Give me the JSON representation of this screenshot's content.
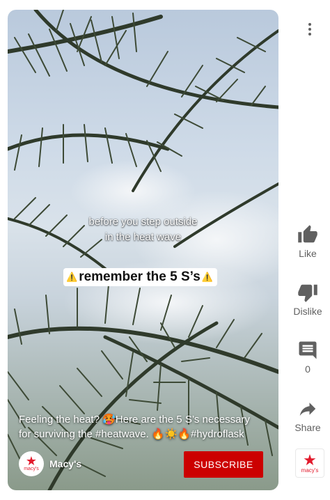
{
  "video": {
    "caption_line1": "before you step outside",
    "caption_line2": "in the heat wave",
    "highlight_text": "remember the 5 S’s",
    "warning_glyph": "⚠️",
    "description_line1": "Feeling the heat? 🥵Here are the 5 S’s necessary",
    "description_line2": "for surviving the #heatwave. 🔥☀️🔥#hydroflask"
  },
  "channel": {
    "name": "Macy's",
    "avatar_star": "★",
    "avatar_text": "macy's",
    "subscribe_label": "SUBSCRIBE"
  },
  "actions": {
    "more_icon": "more-vertical-icon",
    "like_label": "Like",
    "dislike_label": "Dislike",
    "comment_count": "0",
    "share_label": "Share"
  },
  "brand_tile": {
    "star": "★",
    "text": "macy's"
  },
  "colors": {
    "subscribe": "#cc0000",
    "brand_red": "#e21a2c",
    "icon_gray": "#606060"
  }
}
